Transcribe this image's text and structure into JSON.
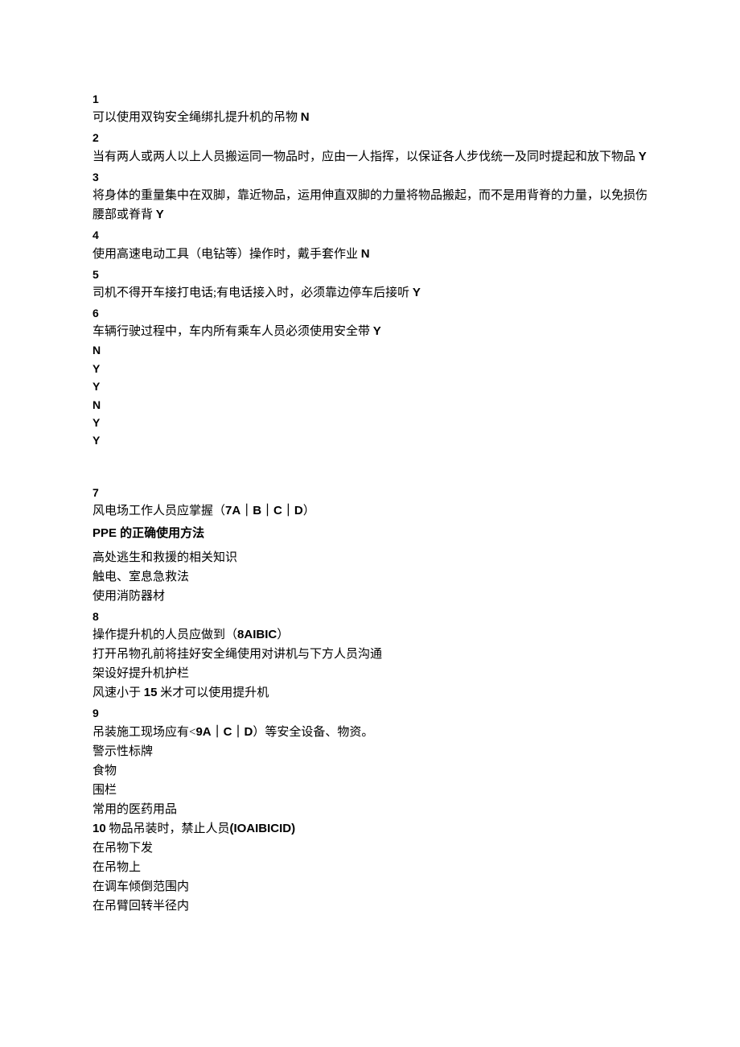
{
  "questions_tf": [
    {
      "num": "1",
      "text_pre": "可以使用双钩安全绳绑扎提升机的吊物 ",
      "ans": "N",
      "text_post": ""
    },
    {
      "num": "2",
      "text_pre": "当有两人或两人以上人员搬运同一物品时，应由一人指挥，以保证各人步伐统一及同时提起和放下物品 ",
      "ans": "Y",
      "text_post": ""
    },
    {
      "num": "3",
      "text_pre": "将身体的重量集中在双脚，靠近物品，运用伸直双脚的力量将物品搬起，而不是用背脊的力量，以免损伤腰部或脊背 ",
      "ans": "Y",
      "text_post": ""
    },
    {
      "num": "4",
      "text_pre": "使用高速电动工具（电钻等）操作时，戴手套作业 ",
      "ans": "N",
      "text_post": ""
    },
    {
      "num": "5",
      "text_pre": "司机不得开车接打电话;有电话接入时，必须靠边停车后接听 ",
      "ans": "Y",
      "text_post": ""
    },
    {
      "num": "6",
      "text_pre": "车辆行驶过程中，车内所有乘车人员必须使用安全带 ",
      "ans": "Y",
      "text_post": ""
    }
  ],
  "yn_summary": [
    "N",
    "Y",
    "Y",
    "N",
    "Y",
    "Y"
  ],
  "q7": {
    "num": "7",
    "text_pre": "风电场工作人员应掌握（",
    "code": "7A｜B｜C｜D",
    "text_post": "）",
    "opts": [
      "PPE 的正确使用方法",
      "高处逃生和救援的相关知识",
      "触电、室息急救法",
      "使用消防器材"
    ]
  },
  "q8": {
    "num": "8",
    "text_pre": "操作提升机的人员应做到（",
    "code": "8AIBIC",
    "text_post": "）",
    "opts": [
      "打开吊物孔前将挂好安全绳使用对讲机与下方人员沟通",
      "架设好提升机护栏",
      "风速小于 15 米才可以使用提升机"
    ],
    "opt_bold_idx": 2,
    "opt_bold_token": "15"
  },
  "q9": {
    "num": "9",
    "text_pre": "吊装施工现场应有<",
    "code": "9A｜C｜D",
    "text_post": "）等安全设备、物资。",
    "opts": [
      "警示性标牌",
      "食物",
      "围栏",
      "常用的医药用品"
    ]
  },
  "q10": {
    "num": "10",
    "text_pre": " 物品吊装时，禁止人员",
    "code": "(IOAIBICID)",
    "opts": [
      "在吊物下发",
      "在吊物上",
      "在调车倾倒范围内",
      "在吊臂回转半径内"
    ]
  }
}
